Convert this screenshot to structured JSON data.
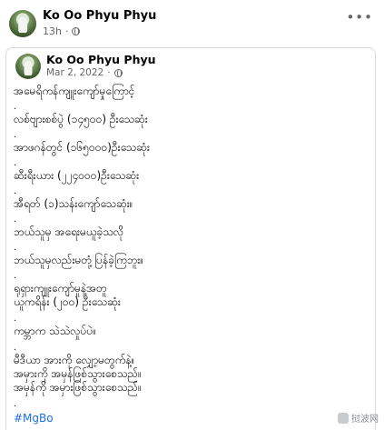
{
  "outer_post": {
    "author": "Ko Oo Phyu Phyu",
    "time": "13h",
    "more_label": "•••"
  },
  "shared_post": {
    "author": "Ko Oo Phyu Phyu",
    "date": "Mar 2, 2022",
    "lines": [
      "အမေရိကန်ကျူးကျော်မှုကြောင့်",
      "လစ်ဗျားစစ်ပွဲ (၁၄၅၀၀) ဦးသေဆုံး",
      "အာဖဂန်တွင် (၁၆၅၀၀၀)ဦးသေဆုံး",
      "ဆီးရီးယား (၂၂၄၀၀၀)ဦးသေဆုံး",
      "အီရတ် (၁)သန်းကျော်သေဆုံး။",
      "ဘယ်သူမှ အရေးမယူခဲ့သလို",
      "ဘယ်သူမှလည်းမတုံ့ပြန်ခဲ့ကြဘူး။",
      "ရုရှားကျူးကျော်မှုနဲ့အတူ",
      "ယူကရိန်း (၂၀၀)  ဦးသေဆုံး",
      "ကမ္ဘာက သဲသဲလှုပ်ပဲ။",
      "မီဒီယာ အားကို လျှော့မတွက်နဲ့။",
      "အမှားကို အမှန်ဖြစ်သွားစေသည်။",
      "အမှန်ကို အမှားဖြစ်သွားစေသည်။"
    ],
    "dot": ".",
    "hashtag": "#MgBo"
  },
  "watermark": "挝波网"
}
